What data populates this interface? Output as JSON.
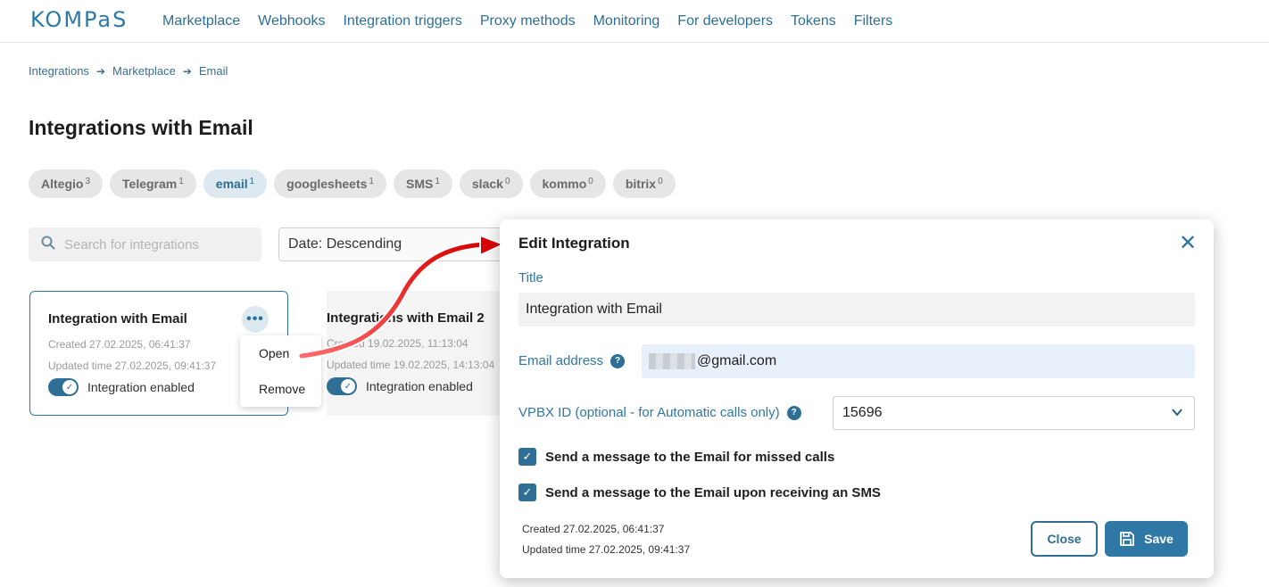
{
  "header": {
    "logo": "KOMPaS",
    "nav": [
      "Marketplace",
      "Webhooks",
      "Integration triggers",
      "Proxy methods",
      "Monitoring",
      "For developers",
      "Tokens",
      "Filters"
    ]
  },
  "breadcrumb": [
    "Integrations",
    "Marketplace",
    "Email"
  ],
  "page_title": "Integrations with Email",
  "chips": [
    {
      "label": "Altegio",
      "count": "3"
    },
    {
      "label": "Telegram",
      "count": "1"
    },
    {
      "label": "email",
      "count": "1"
    },
    {
      "label": "googlesheets",
      "count": "1"
    },
    {
      "label": "SMS",
      "count": "1"
    },
    {
      "label": "slack",
      "count": "0"
    },
    {
      "label": "kommo",
      "count": "0"
    },
    {
      "label": "bitrix",
      "count": "0"
    }
  ],
  "search": {
    "placeholder": "Search for integrations"
  },
  "sort": {
    "value": "Date: Descending"
  },
  "card1": {
    "title": "Integration with Email",
    "created": "Created 27.02.2025, 06:41:37",
    "updated": "Updated time 27.02.2025, 09:41:37",
    "toggle_label": "Integration enabled",
    "menu": [
      "Open",
      "Remove"
    ]
  },
  "card2": {
    "title": "Integrations with Email 2",
    "created": "Created 19.02.2025, 11:13:04",
    "updated": "Updated time 19.02.2025, 14:13:04",
    "toggle_label": "Integration enabled"
  },
  "modal": {
    "title": "Edit Integration",
    "title_label": "Title",
    "title_value": "Integration with Email",
    "email_label": "Email address",
    "email_value": "@gmail.com",
    "vpbx_label": "VPBX ID (optional - for Automatic calls only)",
    "vpbx_value": "15696",
    "check1": "Send a message to the Email for missed calls",
    "check2": "Send a message to the Email upon receiving an SMS",
    "created": "Created 27.02.2025, 06:41:37",
    "updated": "Updated time 27.02.2025, 09:41:37",
    "close_button": "Close",
    "save_button": "Save"
  },
  "colors": {
    "accent": "#2f6f96",
    "annotation_arrow": "#e00000"
  }
}
